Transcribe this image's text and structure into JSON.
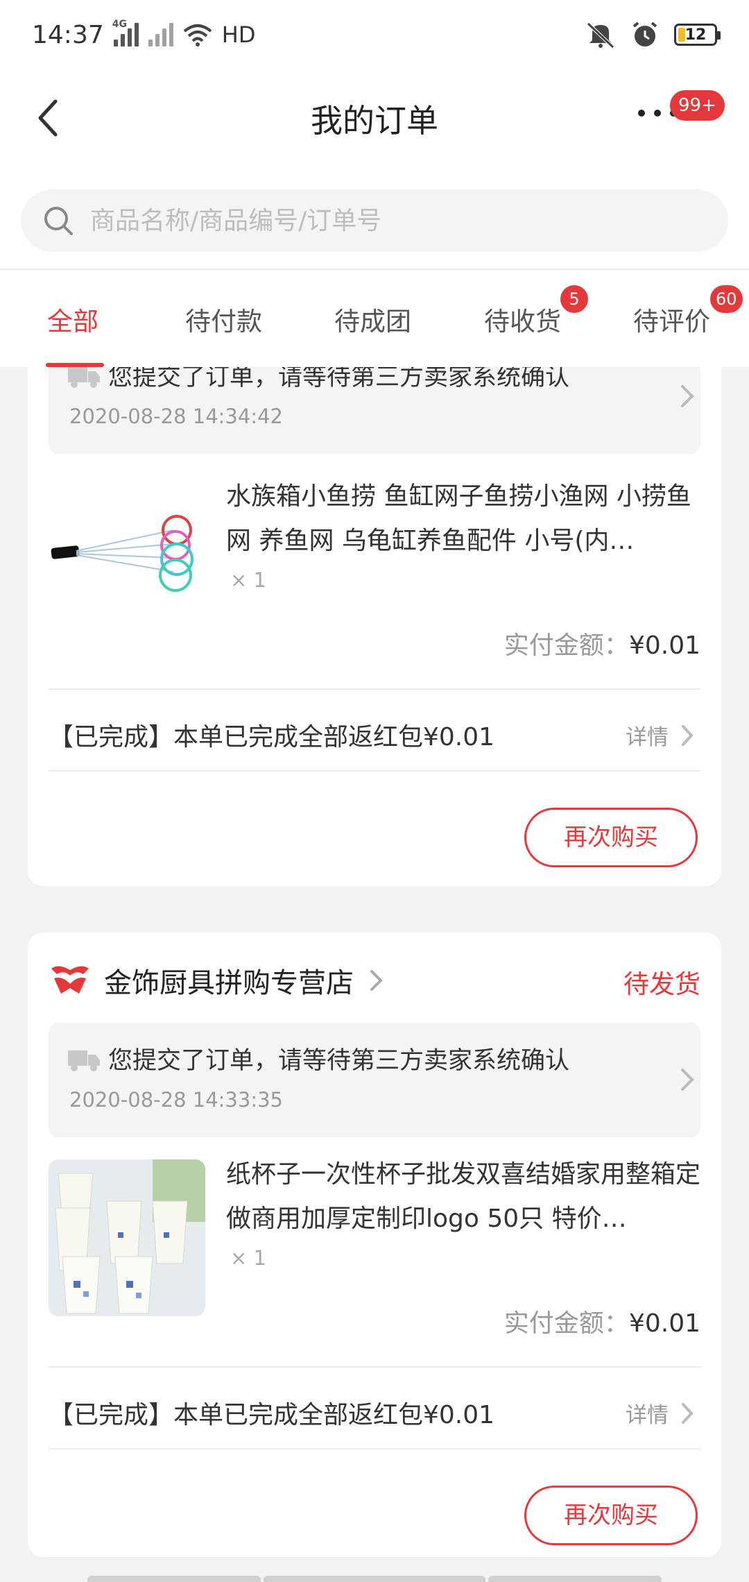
{
  "status_bar": {
    "time": "14:37",
    "network_label": "4G",
    "wifi_label": "HD",
    "battery": "12"
  },
  "nav": {
    "title": "我的订单",
    "more_badge": "99+"
  },
  "search": {
    "placeholder": "商品名称/商品编号/订单号"
  },
  "tabs": [
    {
      "label": "全部",
      "active": true
    },
    {
      "label": "待付款"
    },
    {
      "label": "待成团"
    },
    {
      "label": "待收货",
      "badge": "5"
    },
    {
      "label": "待评价",
      "badge": "60"
    }
  ],
  "orders": [
    {
      "logistics_text": "您提交了订单，请等待第三方卖家系统确认",
      "logistics_time": "2020-08-28 14:34:42",
      "product_name": "水族箱小鱼捞 鱼缸网子鱼捞小渔网 小捞鱼网 养鱼网 乌龟缸养鱼配件 小号(内…",
      "qty": "× 1",
      "paid_label": "实付金额：",
      "paid_amount": "¥0.01",
      "rebate_text": "【已完成】本单已完成全部返红包¥0.01",
      "detail_label": "详情",
      "rebuy_label": "再次购买"
    },
    {
      "shop_name": "金饰厨具拼购专营店",
      "status": "待发货",
      "logistics_text": "您提交了订单，请等待第三方卖家系统确认",
      "logistics_time": "2020-08-28 14:33:35",
      "product_name": "纸杯子一次性杯子批发双喜结婚家用整箱定做商用加厚定制印logo 50只 特价…",
      "qty": "× 1",
      "paid_label": "实付金额：",
      "paid_amount": "¥0.01",
      "rebate_text": "【已完成】本单已完成全部返红包¥0.01",
      "detail_label": "详情",
      "rebuy_label": "再次购买"
    }
  ],
  "colors": {
    "accent": "#e5383b",
    "background": "#f2f2f2"
  }
}
